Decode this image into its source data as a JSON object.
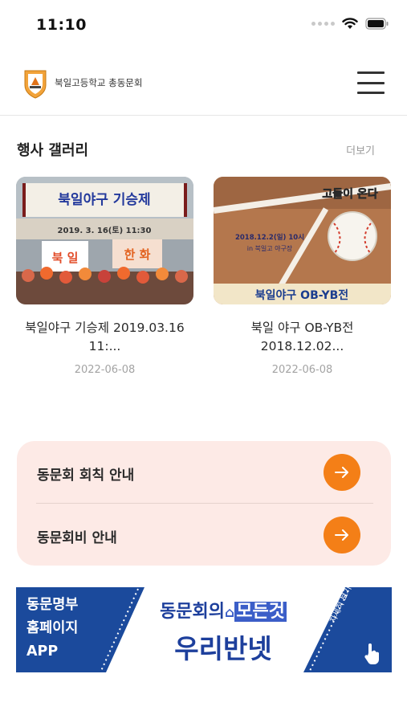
{
  "status_bar": {
    "time": "11:10"
  },
  "header": {
    "title": "북일고등학교 총동문회",
    "logo_icon": "school-emblem-icon",
    "menu_icon": "hamburger-menu-icon"
  },
  "gallery": {
    "title": "행사 갤러리",
    "more_label": "더보기",
    "items": [
      {
        "title_line1": "북일야구 기승제 2019.03.16",
        "title_line2": "11:...",
        "date": "2022-06-08",
        "image_text": {
          "headline": "북일야구 기승제",
          "datetime": "2019. 3. 16(토) 11:30",
          "banner_a": "북 일",
          "banner_b": "한 화"
        }
      },
      {
        "title_line1": "북일 야구 OB-YB전",
        "title_line2": "2018.12.02...",
        "date": "2022-06-08",
        "image_text": {
          "top_line": "고들이 온다",
          "datetime": "2018.12.2(일) 10시",
          "place": "in 북일고 야구장",
          "bottom_line": "북일야구 OB-YB전"
        }
      }
    ]
  },
  "info_menu": [
    {
      "label": "동문회 회칙 안내",
      "icon": "arrow-right-icon"
    },
    {
      "label": "동문회비 안내",
      "icon": "arrow-right-icon"
    }
  ],
  "banner": {
    "left_lines": [
      "동문명부",
      "홈페이지",
      "APP"
    ],
    "top_line_a": "동문회의",
    "top_line_b": "모든것",
    "main": "우리반넷",
    "side": "자세히 보기",
    "colors": {
      "blue": "#1b4a9c",
      "orange_accent": "#f47f17"
    }
  }
}
